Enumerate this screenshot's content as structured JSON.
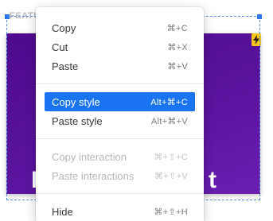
{
  "frame": {
    "label": "FEATU",
    "ghost_text_left": "I",
    "ghost_text_right": "t",
    "badge_icon": "lightning-bolt-icon",
    "colors": {
      "canvas": "#5a149f",
      "selection": "#2f74f0",
      "badge": "#f5c518"
    }
  },
  "context_menu": {
    "groups": [
      [
        {
          "label": "Copy",
          "shortcut": "⌘+C"
        },
        {
          "label": "Cut",
          "shortcut": "⌘+X"
        },
        {
          "label": "Paste",
          "shortcut": "⌘+V"
        }
      ],
      [
        {
          "label": "Copy style",
          "shortcut": "Alt+⌘+C",
          "state": "highlighted"
        },
        {
          "label": "Paste style",
          "shortcut": "Alt+⌘+V"
        }
      ],
      [
        {
          "label": "Copy interaction",
          "shortcut": "⌘+⇧+C",
          "state": "disabled"
        },
        {
          "label": "Paste interactions",
          "shortcut": "⌘+⇧+V",
          "state": "disabled"
        }
      ],
      [
        {
          "label": "Hide",
          "shortcut": "⌘+⇧+H"
        }
      ]
    ],
    "colors": {
      "highlight": "#1a73f0"
    }
  }
}
